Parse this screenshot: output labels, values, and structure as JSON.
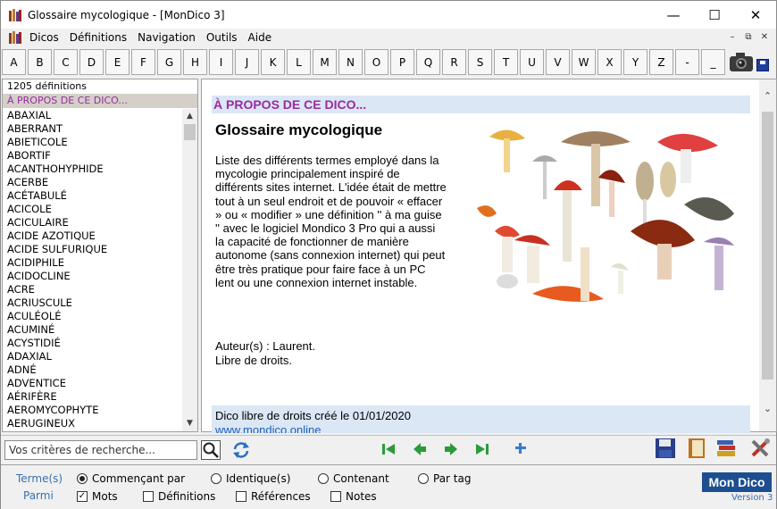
{
  "window": {
    "title": "Glossaire mycologique - [MonDico 3]",
    "minimize": "—",
    "maximize": "☐",
    "close": "✕"
  },
  "menu": {
    "items": [
      "Dicos",
      "Définitions",
      "Navigation",
      "Outils",
      "Aide"
    ],
    "mdi": [
      "–",
      "⧉",
      "✕"
    ]
  },
  "letters": [
    "A",
    "B",
    "C",
    "D",
    "E",
    "F",
    "G",
    "H",
    "I",
    "J",
    "K",
    "L",
    "M",
    "N",
    "O",
    "P",
    "Q",
    "R",
    "S",
    "T",
    "U",
    "V",
    "W",
    "X",
    "Y",
    "Z",
    "-",
    "_"
  ],
  "list": {
    "count": "1205 définitions",
    "selected": "À PROPOS DE CE DICO...",
    "words": [
      "ABAXIAL",
      "ABERRANT",
      "ABIETICOLE",
      "ABORTIF",
      "ACANTHOHYPHIDE",
      "ACERBE",
      "ACÉTABULÉ",
      "ACICOLE",
      "ACICULAIRE",
      "ACIDE AZOTIQUE",
      "ACIDE SULFURIQUE",
      "ACIDIPHILE",
      "ACIDOCLINE",
      "ACRE",
      "ACRIUSCULE",
      "ACULÉOLÉ",
      "ACUMINÉ",
      "ACYSTIDIÉ",
      "ADAXIAL",
      "ADNÉ",
      "ADVENTICE",
      "AÉRIFÈRE",
      "AEROMYCOPHYTE",
      "AERUGINEUX"
    ]
  },
  "content": {
    "section_title": "À PROPOS DE CE DICO...",
    "heading": "Glossaire mycologique",
    "description": "Liste des différents termes employé dans la mycologie principalement inspiré de différents sites internet. L'idée était de mettre tout à un seul endroit et de pouvoir « effacer » ou « modifier » une définition '' à ma guise '' avec le logiciel Mondico 3 Pro qui a aussi la capacité de fonctionner de manière autonome (sans connexion internet) qui peut être très pratique pour faire face à un PC lent ou une connexion internet instable.",
    "author": "Auteur(s) : Laurent.",
    "license": "Libre de droits.",
    "footer_text": "Dico libre de droits créé le 01/01/2020",
    "footer_link": "www.mondico.online"
  },
  "search": {
    "placeholder": "Vos critères de recherche..."
  },
  "options": {
    "term_label": "Terme(s)",
    "among_label": "Parmi",
    "radios": [
      "Commençant par",
      "Identique(s)",
      "Contenant",
      "Par tag"
    ],
    "checks": [
      "Mots",
      "Définitions",
      "Références",
      "Notes"
    ]
  },
  "brand": {
    "name": "Mon Dico",
    "version": "Version 3"
  },
  "colors": {
    "accent_purple": "#9a2aa0",
    "header_bg": "#dbe7f5",
    "link_blue": "#1a5fbf",
    "brand_bg": "#1d4e8f",
    "nav_green": "#2a9a3a"
  }
}
